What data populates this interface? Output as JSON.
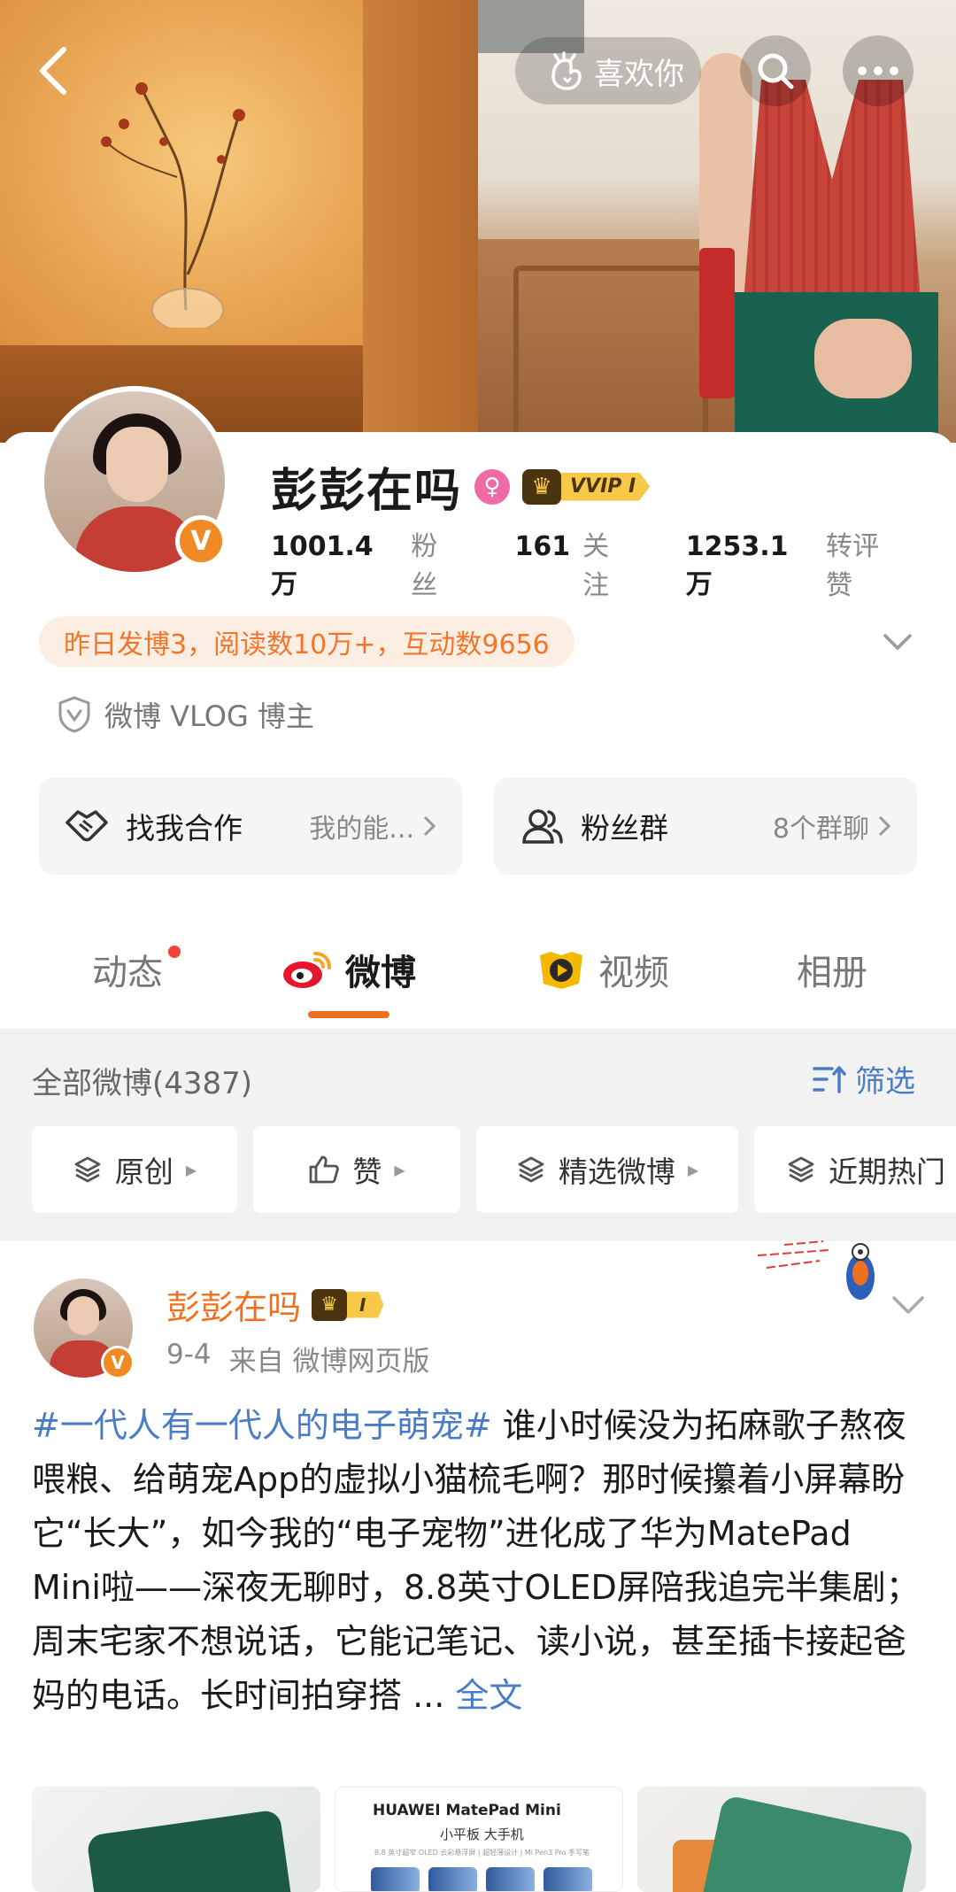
{
  "header": {
    "like_label": "喜欢你"
  },
  "profile": {
    "name": "彭彭在吗",
    "vip_label": "VVIP I",
    "verified_letter": "V",
    "stats": [
      {
        "value": "1001.4万",
        "label": "粉丝"
      },
      {
        "value": "161",
        "label": "关注"
      },
      {
        "value": "1253.1万",
        "label": "转评赞"
      }
    ],
    "activity_text": "昨日发博3，阅读数10万+，互动数9656",
    "verified_title": "微博 VLOG 博主",
    "cooperation": {
      "title": "找我合作",
      "sub": "我的能..."
    },
    "fan_group": {
      "title": "粉丝群",
      "sub": "8个群聊"
    }
  },
  "tabs": [
    {
      "label": "动态"
    },
    {
      "label": "微博"
    },
    {
      "label": "视频"
    },
    {
      "label": "相册"
    }
  ],
  "feed": {
    "all_count": "全部微博(4387)",
    "filter_label": "筛选",
    "chips": [
      "原创",
      "赞",
      "精选微博",
      "近期热门"
    ]
  },
  "post": {
    "author": "彭彭在吗",
    "vip_label": "I",
    "date": "9-4",
    "source": "来自 微博网页版",
    "hashtag": "#一代人有一代人的电子萌宠#",
    "body": " 谁小时候没为拓麻歌子熬夜喂粮、给萌宠App的虚拟小猫梳毛啊？那时候攥着小屏幕盼它“长大”，如今我的“电子宠物”进化成了华为MatePad Mini啦——深夜无聊时，8.8英寸OLED屏陪我追完半集剧；周末宅家不想说话，它能记笔记、读小说，甚至插卡接起爸妈的电话。长时间拍穿搭 ...",
    "more_label": "全文",
    "thumb_brand": "HUAWEI MatePad Mini",
    "thumb_sub": "小平板  大手机",
    "thumb_fine": "8.8 英寸超窄 OLED 云彩悬浮屏 | 超轻薄设计 | Mi Pen3 Pro 手写笔"
  },
  "colors": {
    "accent_orange": "#f07022",
    "link_blue": "#4a7cc5",
    "vip_gold": "#f7c948"
  }
}
